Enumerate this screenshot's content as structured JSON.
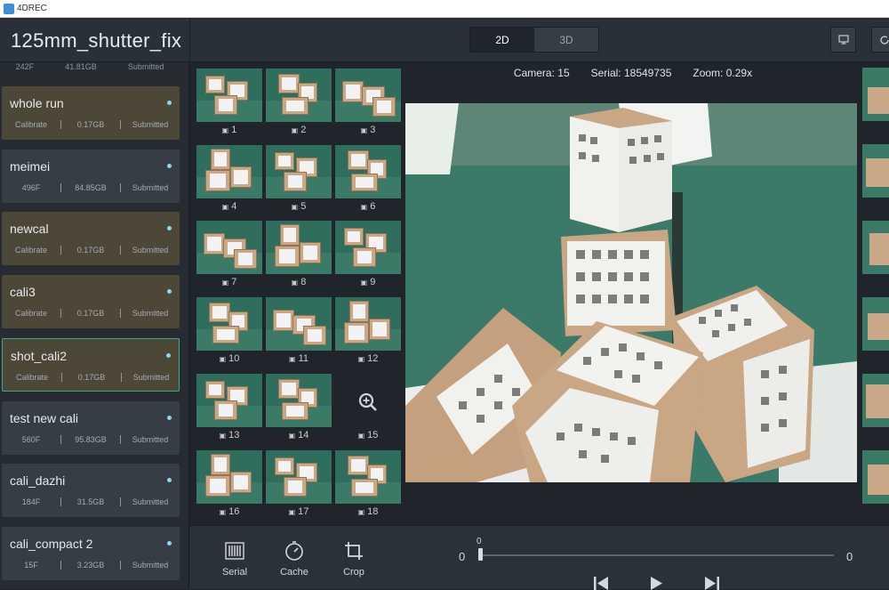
{
  "window": {
    "title": "4DREC"
  },
  "header": {
    "project_title": "125mm_shutter_fix",
    "modes": [
      {
        "label": "2D",
        "active": true
      },
      {
        "label": "3D",
        "active": false
      }
    ],
    "monitor_icon": "monitor-icon",
    "refresh_icon": "refresh-icon"
  },
  "sidebar": {
    "top_partial": {
      "frames": "242F",
      "size": "41.81GB",
      "status": "Submitted"
    },
    "items": [
      {
        "name": "whole run",
        "col1": "Calibrate",
        "col2": "0.17GB",
        "status": "Submitted",
        "type": "calibrate"
      },
      {
        "name": "meimei",
        "col1": "496F",
        "col2": "84.85GB",
        "status": "Submitted",
        "type": "shot"
      },
      {
        "name": "newcal",
        "col1": "Calibrate",
        "col2": "0.17GB",
        "status": "Submitted",
        "type": "calibrate"
      },
      {
        "name": "cali3",
        "col1": "Calibrate",
        "col2": "0.17GB",
        "status": "Submitted",
        "type": "calibrate"
      },
      {
        "name": "shot_cali2",
        "col1": "Calibrate",
        "col2": "0.17GB",
        "status": "Submitted",
        "type": "calibrate",
        "selected": true
      },
      {
        "name": "test new cali",
        "col1": "560F",
        "col2": "95.83GB",
        "status": "Submitted",
        "type": "shot"
      },
      {
        "name": "cali_dazhi",
        "col1": "184F",
        "col2": "31.5GB",
        "status": "Submitted",
        "type": "shot"
      },
      {
        "name": "cali_compact 2",
        "col1": "15F",
        "col2": "3.23GB",
        "status": "Submitted",
        "type": "shot"
      }
    ]
  },
  "cameras": {
    "labels": [
      "1",
      "2",
      "3",
      "4",
      "5",
      "6",
      "7",
      "8",
      "9",
      "10",
      "11",
      "12",
      "13",
      "14",
      "15",
      "16",
      "17",
      "18"
    ],
    "empty_slot": "15",
    "camera_icon": "camera-icon",
    "zoom_icon": "zoom-in-icon"
  },
  "viewer": {
    "camera": "Camera: 15",
    "serial": "Serial: 18549735",
    "zoom": "Zoom: 0.29x"
  },
  "toolbar": {
    "tools": [
      {
        "label": "Serial",
        "icon": "barcode-icon"
      },
      {
        "label": "Cache",
        "icon": "cache-icon"
      },
      {
        "label": "Crop",
        "icon": "crop-icon"
      }
    ]
  },
  "timeline": {
    "min": "0",
    "max": "0",
    "current": "0"
  },
  "playback": {
    "icons": [
      "skip-back-icon",
      "play-icon",
      "skip-forward-icon"
    ]
  },
  "colors": {
    "calibrate_card": "#4d4738",
    "shot_card": "#363d45",
    "selected_border": "#3ba98d",
    "status_dot": "#8fd6ea"
  }
}
